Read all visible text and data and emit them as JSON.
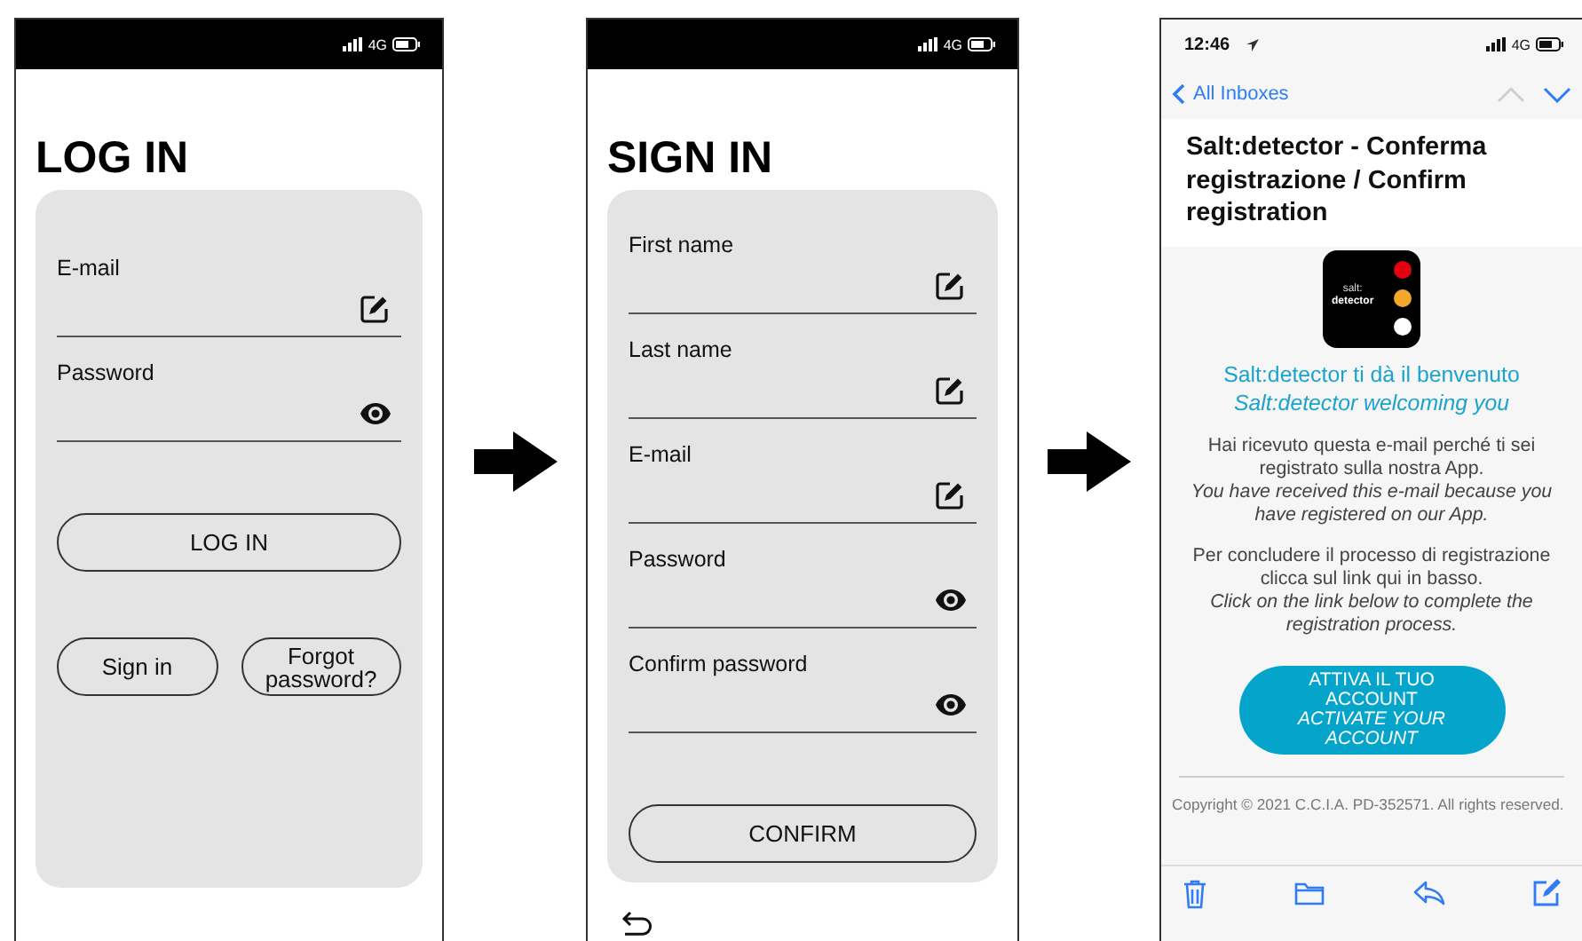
{
  "login_screen": {
    "network": "4G",
    "title": "LOG IN",
    "fields": [
      {
        "label": "E-mail",
        "kind": "text"
      },
      {
        "label": "Password",
        "kind": "password"
      }
    ],
    "primary_button": "LOG IN",
    "secondary_buttons": [
      "Sign in",
      "Forgot password?"
    ]
  },
  "signin_screen": {
    "network": "4G",
    "title": "SIGN IN",
    "fields": [
      {
        "label": "First name",
        "kind": "text"
      },
      {
        "label": "Last name",
        "kind": "text"
      },
      {
        "label": "E-mail",
        "kind": "text"
      },
      {
        "label": "Password",
        "kind": "password"
      },
      {
        "label": "Confirm password",
        "kind": "password"
      }
    ],
    "primary_button": "CONFIRM"
  },
  "email_screen": {
    "time": "12:46",
    "network": "4G",
    "back_link": "All Inboxes",
    "subject": "Salt:detector - Conferma registrazione / Confirm registration",
    "logo_text": [
      "salt:",
      "detector"
    ],
    "welcome": {
      "it": "Salt:detector ti dà il benvenuto",
      "en": "Salt:detector welcoming you"
    },
    "paragraphs": [
      {
        "it": "Hai ricevuto questa e-mail perché ti sei registrato sulla nostra App.",
        "en": "You have received this e-mail because you have registered on our App."
      },
      {
        "it": "Per concludere il processo di registrazione clicca sul link qui in basso.",
        "en": "Click on the link below to complete the registration process."
      }
    ],
    "button": {
      "it": "ATTIVA IL TUO ACCOUNT",
      "en": "ACTIVATE YOUR ACCOUNT"
    },
    "copyright": "Copyright © 2021 C.C.I.A. PD-352571. All rights reserved."
  }
}
